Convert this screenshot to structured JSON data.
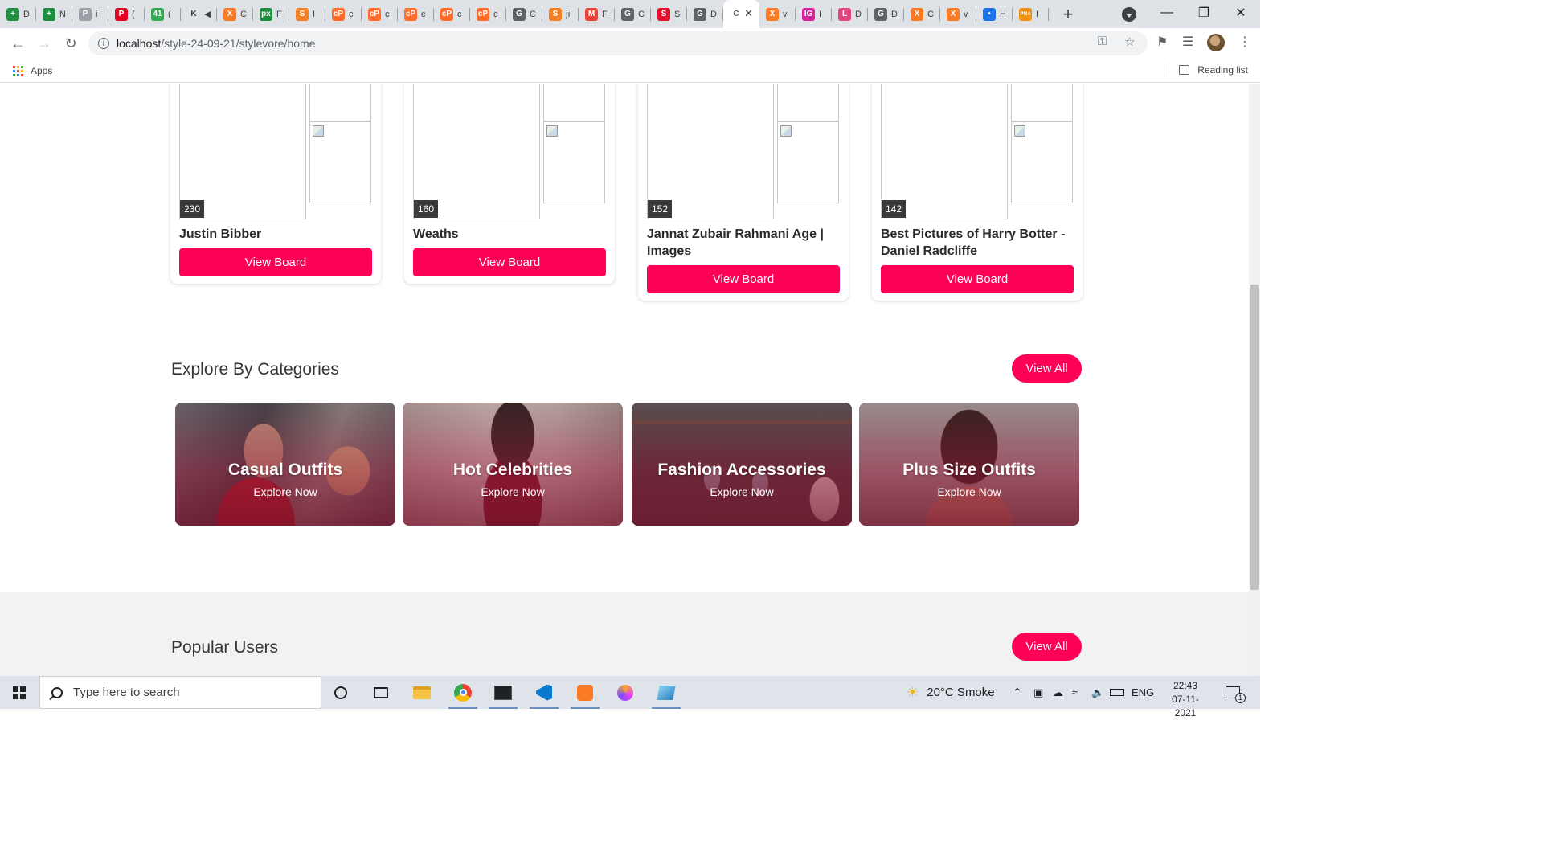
{
  "browser": {
    "tabs": [
      {
        "letter": "+",
        "short": "D",
        "color": "#1e8e3e",
        "icon": "sheets-icon"
      },
      {
        "letter": "+",
        "short": "N",
        "color": "#1e8e3e",
        "icon": "sheets-icon"
      },
      {
        "letter": "P",
        "short": "i",
        "color": "#9aa0a6",
        "icon": "pinterest-gray-icon"
      },
      {
        "letter": "P",
        "short": "(",
        "color": "#e60023",
        "icon": "pinterest-icon"
      },
      {
        "letter": "41",
        "short": "(",
        "color": "#34a853",
        "icon": "badge-icon"
      },
      {
        "letter": "K",
        "short": "◀",
        "color": "#dee1e6",
        "icon": "k-icon"
      },
      {
        "letter": "X",
        "short": "C",
        "color": "#fb7a24",
        "icon": "xampp-icon"
      },
      {
        "letter": "px",
        "short": "F",
        "color": "#1e8e3e",
        "icon": "px-icon"
      },
      {
        "letter": "S",
        "short": "I",
        "color": "#f48024",
        "icon": "stackoverflow-icon"
      },
      {
        "letter": "cP",
        "short": "c",
        "color": "#ff6c2c",
        "icon": "cpanel-icon"
      },
      {
        "letter": "cP",
        "short": "c",
        "color": "#ff6c2c",
        "icon": "cpanel-icon"
      },
      {
        "letter": "cP",
        "short": "c",
        "color": "#ff6c2c",
        "icon": "cpanel-icon"
      },
      {
        "letter": "cP",
        "short": "c",
        "color": "#ff6c2c",
        "icon": "cpanel-icon"
      },
      {
        "letter": "cP",
        "short": "c",
        "color": "#ff6c2c",
        "icon": "cpanel-icon"
      },
      {
        "letter": "G",
        "short": "C",
        "color": "#5f6368",
        "icon": "globe-icon"
      },
      {
        "letter": "S",
        "short": "jı",
        "color": "#f48024",
        "icon": "stackoverflow-icon"
      },
      {
        "letter": "M",
        "short": "F",
        "color": "#ea4335",
        "icon": "gmail-icon"
      },
      {
        "letter": "G",
        "short": "C",
        "color": "#5f6368",
        "icon": "globe-icon"
      },
      {
        "letter": "S",
        "short": "S",
        "color": "#e8112d",
        "icon": "s-icon"
      },
      {
        "letter": "G",
        "short": "D",
        "color": "#5f6368",
        "icon": "globe-icon"
      },
      {
        "letter": "C",
        "short": "",
        "color": "#ffffff",
        "icon": "active-tab-icon",
        "active": true
      },
      {
        "letter": "X",
        "short": "v",
        "color": "#fb7a24",
        "icon": "xampp-icon"
      },
      {
        "letter": "IG",
        "short": "I",
        "color": "#d6249f",
        "icon": "instagram-icon"
      },
      {
        "letter": "L",
        "short": "D",
        "color": "#e0457b",
        "icon": "laravel-icon"
      },
      {
        "letter": "G",
        "short": "D",
        "color": "#5f6368",
        "icon": "globe-icon"
      },
      {
        "letter": "X",
        "short": "C",
        "color": "#fb7a24",
        "icon": "xampp-icon"
      },
      {
        "letter": "X",
        "short": "v",
        "color": "#fb7a24",
        "icon": "xampp-icon"
      },
      {
        "letter": "•",
        "short": "H",
        "color": "#1a73e8",
        "icon": "dot-icon"
      },
      {
        "letter": "PMA",
        "short": "I",
        "color": "#f29111",
        "icon": "phpmyadmin-icon"
      }
    ],
    "url_host": "localhost",
    "url_path": "/style-24-09-21/stylevore/home",
    "bookmarks_apps": "Apps",
    "reading_list": "Reading list"
  },
  "boards": [
    {
      "title": "Justin Bibber",
      "count": "230",
      "button": "View Board"
    },
    {
      "title": "Weaths",
      "count": "160",
      "button": "View Board"
    },
    {
      "title": "Jannat Zubair Rahmani Age | Images",
      "count": "152",
      "button": "View Board"
    },
    {
      "title": "Best Pictures of Harry Botter - Daniel Radcliffe",
      "count": "142",
      "button": "View Board"
    }
  ],
  "categories_section": {
    "title": "Explore By Categories",
    "view_all": "View All",
    "items": [
      {
        "name": "Casual Outfits",
        "cta": "Explore Now"
      },
      {
        "name": "Hot Celebrities",
        "cta": "Explore Now"
      },
      {
        "name": "Fashion Accessories",
        "cta": "Explore Now"
      },
      {
        "name": "Plus Size Outfits",
        "cta": "Explore Now"
      }
    ]
  },
  "popular_users": {
    "title": "Popular Users",
    "view_all": "View All"
  },
  "taskbar": {
    "search_placeholder": "Type here to search",
    "weather": "20°C  Smoke",
    "lang": "ENG",
    "time": "22:43",
    "date": "07-11-2021",
    "notifications": "1"
  },
  "colors": {
    "accent": "#fe0054",
    "chrome_tabstrip": "#dee1e6"
  }
}
